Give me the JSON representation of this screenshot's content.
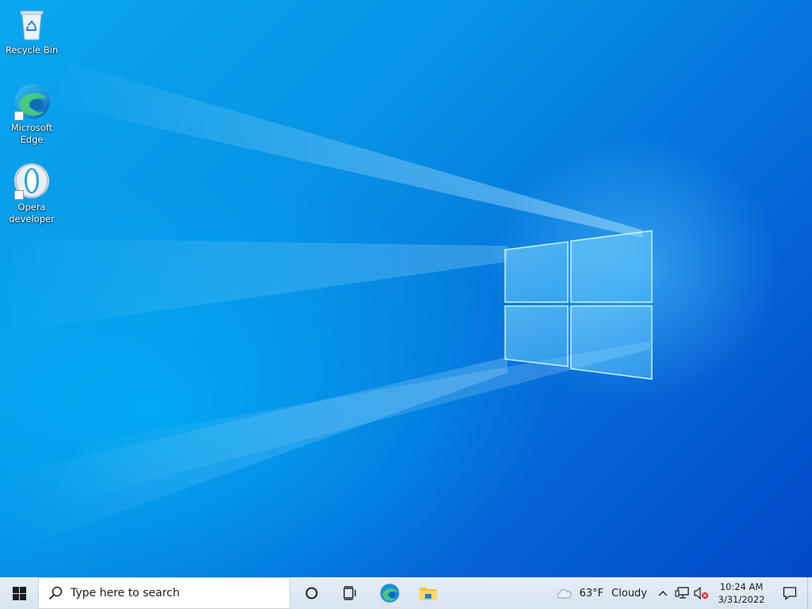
{
  "desktop": {
    "icons": [
      {
        "label": "Recycle Bin",
        "icon": "recycle-bin-icon"
      },
      {
        "label": "Microsoft\nEdge",
        "icon": "edge-icon"
      },
      {
        "label": "Opera\ndeveloper",
        "icon": "opera-icon"
      }
    ]
  },
  "taskbar": {
    "start_icon": "windows-logo-icon",
    "search": {
      "placeholder": "Type here to search",
      "icon": "search-icon"
    },
    "apps": [
      {
        "name": "Cortana",
        "icon": "cortana-circle-icon"
      },
      {
        "name": "Task View",
        "icon": "task-view-icon"
      },
      {
        "name": "Microsoft Edge",
        "icon": "edge-icon"
      },
      {
        "name": "File Explorer",
        "icon": "folder-icon"
      }
    ],
    "weather": {
      "temp": "63°F",
      "condition": "Cloudy",
      "icon": "cloud-icon"
    },
    "tray": {
      "chevron_icon": "chevron-up-icon",
      "network_icon": "network-icon",
      "volume_icon": "volume-muted-icon"
    },
    "clock": {
      "time": "10:24 AM",
      "date": "3/31/2022"
    },
    "notification_icon": "notification-icon"
  },
  "colors": {
    "wallpaper_accent": "#0793e6",
    "taskbar_bg": "#dce6f2",
    "windows_logo": "#0078d7"
  }
}
